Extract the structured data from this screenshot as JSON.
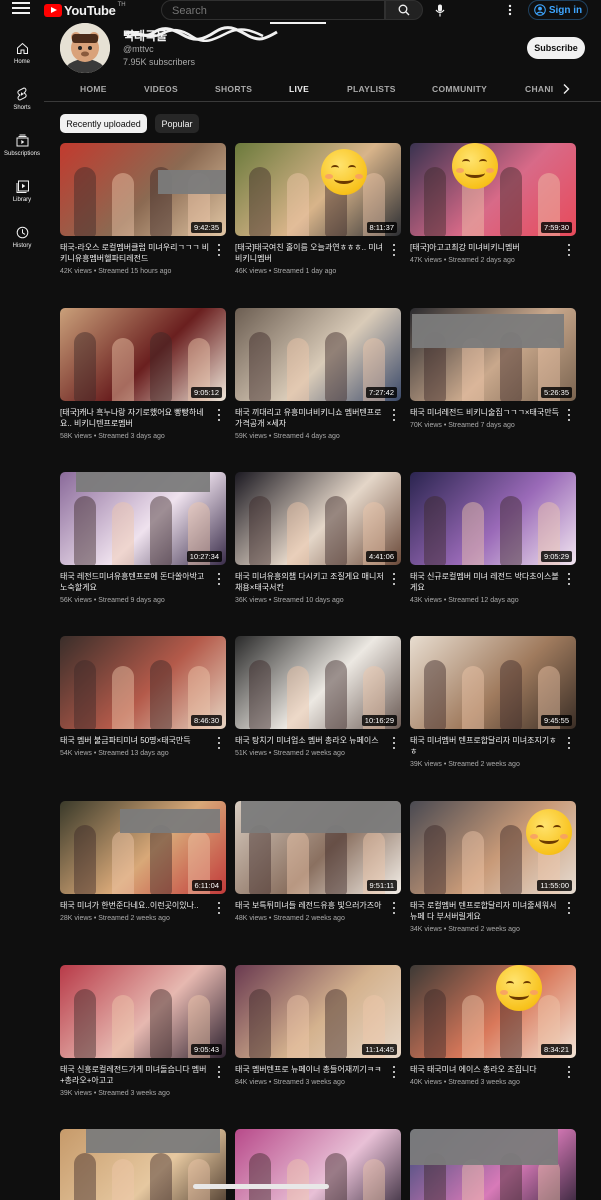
{
  "header": {
    "logo_text": "YouTube",
    "logo_sup": "TH",
    "search_placeholder": "Search",
    "sign_in_label": "Sign in"
  },
  "sidebar": {
    "items": [
      {
        "label": "Home",
        "icon": "home-icon"
      },
      {
        "label": "Shorts",
        "icon": "shorts-icon"
      },
      {
        "label": "Subscriptions",
        "icon": "subscriptions-icon"
      },
      {
        "label": "Library",
        "icon": "library-icon"
      },
      {
        "label": "History",
        "icon": "history-icon"
      }
    ]
  },
  "channel": {
    "name": "먹태국물",
    "handle": "@mttvc",
    "subscribers": "7.95K subscribers",
    "subscribe_label": "Subscribe"
  },
  "tabs": [
    "HOME",
    "VIDEOS",
    "SHORTS",
    "LIVE",
    "PLAYLISTS",
    "COMMUNITY",
    "CHANI"
  ],
  "active_tab": "LIVE",
  "chips": [
    "Recently uploaded",
    "Popular"
  ],
  "selected_chip": "Recently uploaded",
  "videos": [
    {
      "title": "태국-라오스 로컬멤버클럽 미녀우리ㄱㄱㄱ 비키니유흥멤버헬파티레전드",
      "views": "42K views",
      "streamed": "Streamed 15 hours ago",
      "duration": "9:42:35"
    },
    {
      "title": "[태국]태국여친 홀이름 오늘과연ㅎㅎㅎ.. 미녀 비키니멤버",
      "views": "46K views",
      "streamed": "Streamed 1 day ago",
      "duration": "8:11:37"
    },
    {
      "title": "[태국]아고고최강 미녀비키니멤버",
      "views": "47K views",
      "streamed": "Streamed 2 days ago",
      "duration": "7:59:30"
    },
    {
      "title": "[태국]캐나 흑누나랑 자기로했어요 빵빵하네요.. 비키니텐프로멤버",
      "views": "58K views",
      "streamed": "Streamed 3 days ago",
      "duration": "9:05:12"
    },
    {
      "title": "태국 끼대리고 유흥미녀비키니쇼 멤버텐프로 가격공개 ×세자",
      "views": "59K views",
      "streamed": "Streamed 4 days ago",
      "duration": "7:27:42"
    },
    {
      "title": "태국 미녀레전드 비키니술집ㄱㄱㄱ×태국만득",
      "views": "70K views",
      "streamed": "Streamed 7 days ago",
      "duration": "5:26:35"
    },
    {
      "title": "태국 레전드미녀유흥텐프로에 돈다쏠아박고 노숙할게요",
      "views": "56K views",
      "streamed": "Streamed 9 days ago",
      "duration": "10:27:34"
    },
    {
      "title": "태국 미녀유흥의챔 다시키고 조질게요 매니저 채용×태국서칸",
      "views": "36K views",
      "streamed": "Streamed 10 days ago",
      "duration": "4:41:06"
    },
    {
      "title": "태국 신규로컬멤버 미녀 레전드 박다초이스볼게요",
      "views": "43K views",
      "streamed": "Streamed 12 days ago",
      "duration": "9:05:29"
    },
    {
      "title": "태국 멤버 불금파티미녀 50명×태국만득",
      "views": "54K views",
      "streamed": "Streamed 13 days ago",
      "duration": "8:46:30"
    },
    {
      "title": "태국 탕치기 미녀업소 멤버 총라오 뉴페이스",
      "views": "51K views",
      "streamed": "Streamed 2 weeks ago",
      "duration": "10:16:29"
    },
    {
      "title": "태국 미녀멤버 텐프로합달리자 미녀조지기ㅎㅎ",
      "views": "39K views",
      "streamed": "Streamed 2 weeks ago",
      "duration": "9:45:55"
    },
    {
      "title": "태국 미녀가 한번준다네요..이런곳이있나..",
      "views": "28K views",
      "streamed": "Streamed 2 weeks ago",
      "duration": "6:11:04"
    },
    {
      "title": "태국 보특튀미녀들 레전드유흥 빛으러가즈아",
      "views": "48K views",
      "streamed": "Streamed 2 weeks ago",
      "duration": "9:51:11"
    },
    {
      "title": "태국 로컬멤버 텐프로합달리자 미녀줄세워서 뉴페 다 부서버릴게요",
      "views": "34K views",
      "streamed": "Streamed 2 weeks ago",
      "duration": "11:55:00"
    },
    {
      "title": "태국 신흥로컬레전드가게 미녀돌습니다 멤버 +총라오+아고고",
      "views": "39K views",
      "streamed": "Streamed 3 weeks ago",
      "duration": "9:05:43"
    },
    {
      "title": "태국 멤버텐프로 뉴페이너 총들어재끼기ㅋㅋ",
      "views": "84K views",
      "streamed": "Streamed 3 weeks ago",
      "duration": "11:14:45"
    },
    {
      "title": "태국 태국미녀 에이스 총라오 조집니다",
      "views": "40K views",
      "streamed": "Streamed 3 weeks ago",
      "duration": "8:34:21"
    },
    {
      "title": "",
      "views": "",
      "streamed": "",
      "duration": ""
    },
    {
      "title": "",
      "views": "",
      "streamed": "",
      "duration": ""
    },
    {
      "title": "",
      "views": "",
      "streamed": "",
      "duration": ""
    }
  ]
}
